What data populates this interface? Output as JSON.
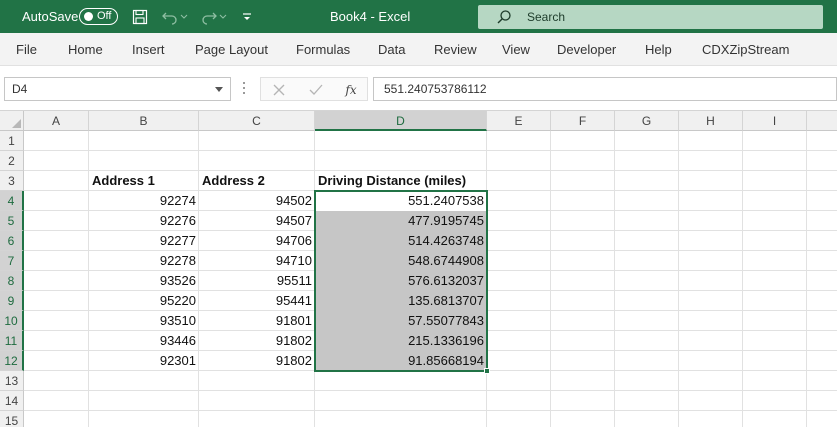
{
  "titlebar": {
    "autosave_label": "AutoSave",
    "autosave_state": "Off",
    "document_title": "Book4  -  Excel",
    "search_placeholder": "Search"
  },
  "ribbon": {
    "tabs": [
      "File",
      "Home",
      "Insert",
      "Page Layout",
      "Formulas",
      "Data",
      "Review",
      "View",
      "Developer",
      "Help",
      "CDXZipStream"
    ]
  },
  "formula_bar": {
    "name_box": "D4",
    "cancel_icon": "close-icon",
    "enter_icon": "check-icon",
    "fx_label": "fx",
    "formula": "551.240753786112"
  },
  "sheet": {
    "columns": [
      "A",
      "B",
      "C",
      "D",
      "E",
      "F",
      "G",
      "H",
      "I"
    ],
    "rows": [
      "1",
      "2",
      "3",
      "4",
      "5",
      "6",
      "7",
      "8",
      "9",
      "10",
      "11",
      "12",
      "13",
      "14",
      "15"
    ],
    "selected_column": "D",
    "selected_rows": [
      "4",
      "5",
      "6",
      "7",
      "8",
      "9",
      "10",
      "11",
      "12"
    ],
    "headers": {
      "address1": "Address 1",
      "address2": "Address 2",
      "distance": "Driving Distance (miles)"
    },
    "data_rows": [
      {
        "address1": "92274",
        "address2": "94502",
        "distance": "551.2407538"
      },
      {
        "address1": "92276",
        "address2": "94507",
        "distance": "477.9195745"
      },
      {
        "address1": "92277",
        "address2": "94706",
        "distance": "514.4263748"
      },
      {
        "address1": "92278",
        "address2": "94710",
        "distance": "548.6744908"
      },
      {
        "address1": "93526",
        "address2": "95511",
        "distance": "576.6132037"
      },
      {
        "address1": "95220",
        "address2": "95441",
        "distance": "135.6813707"
      },
      {
        "address1": "93510",
        "address2": "91801",
        "distance": "57.55077843"
      },
      {
        "address1": "93446",
        "address2": "91802",
        "distance": "215.1336196"
      },
      {
        "address1": "92301",
        "address2": "91802",
        "distance": "91.85668194"
      }
    ]
  },
  "colors": {
    "excel_green": "#217346",
    "search_box": "#b6d7c3",
    "selection_fill": "#c6c6c6"
  }
}
